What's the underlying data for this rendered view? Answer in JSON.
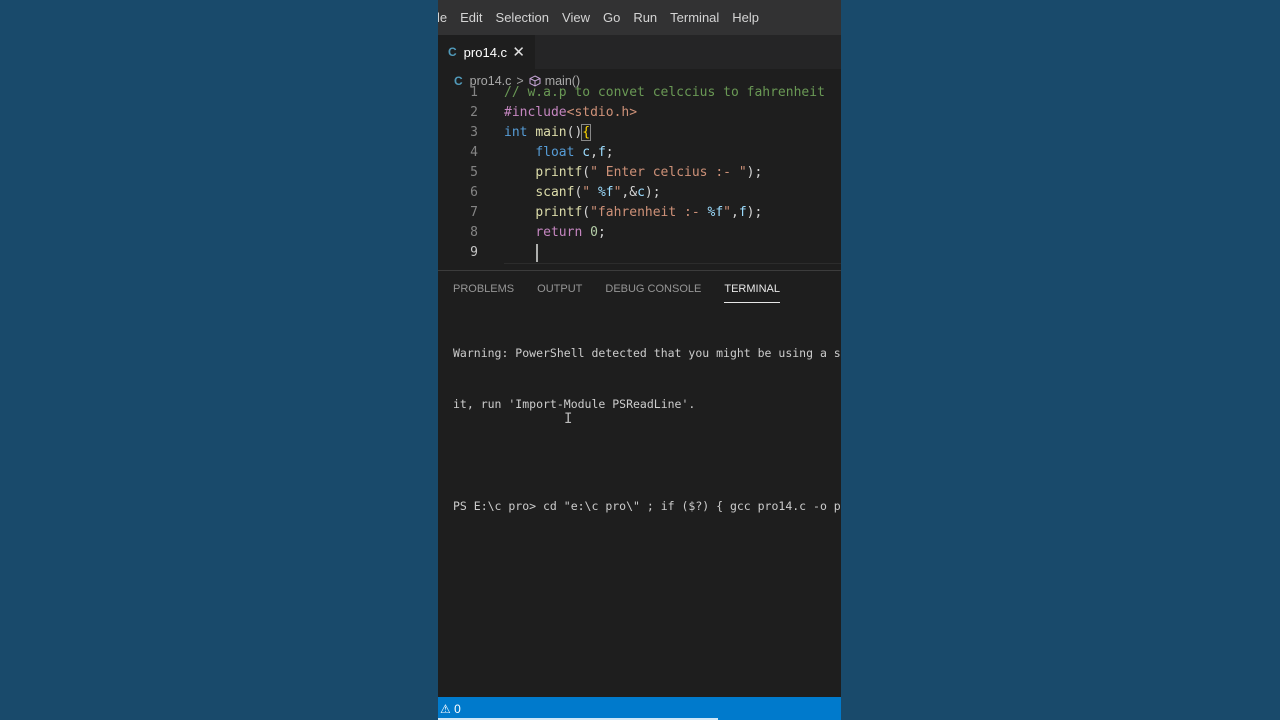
{
  "menu": [
    "le",
    "Edit",
    "Selection",
    "View",
    "Go",
    "Run",
    "Terminal",
    "Help"
  ],
  "tab": {
    "icon": "c-file-icon",
    "icon_text": "C",
    "label": "pro14.c",
    "close_glyph": "✕"
  },
  "breadcrumb": {
    "icon_text": "C",
    "file": "pro14.c",
    "separator": ">",
    "symbol": "main()"
  },
  "editor": {
    "line_numbers": [
      "1",
      "2",
      "3",
      "4",
      "5",
      "6",
      "7",
      "8",
      "9"
    ],
    "lines": [
      [
        {
          "t": "// w.a.p to convet celccius to fahrenheit",
          "c": "comment"
        }
      ],
      [
        {
          "t": "#include",
          "c": "preproc"
        },
        {
          "t": "<stdio.h>",
          "c": "incl"
        }
      ],
      [
        {
          "t": "int",
          "c": "kw"
        },
        {
          "t": " ",
          "c": "punc"
        },
        {
          "t": "main",
          "c": "fn"
        },
        {
          "t": "()",
          "c": "punc"
        },
        {
          "t": "{",
          "c": "brace"
        }
      ],
      [
        {
          "t": "    ",
          "c": "punc"
        },
        {
          "t": "float",
          "c": "kw"
        },
        {
          "t": " ",
          "c": "punc"
        },
        {
          "t": "c",
          "c": "id"
        },
        {
          "t": ",",
          "c": "punc"
        },
        {
          "t": "f",
          "c": "id"
        },
        {
          "t": ";",
          "c": "punc"
        }
      ],
      [
        {
          "t": "    ",
          "c": "punc"
        },
        {
          "t": "printf",
          "c": "fn"
        },
        {
          "t": "(",
          "c": "punc"
        },
        {
          "t": "\" Enter celcius :- \"",
          "c": "str"
        },
        {
          "t": ");",
          "c": "punc"
        }
      ],
      [
        {
          "t": "    ",
          "c": "punc"
        },
        {
          "t": "scanf",
          "c": "fn"
        },
        {
          "t": "(",
          "c": "punc"
        },
        {
          "t": "\" ",
          "c": "str"
        },
        {
          "t": "%f",
          "c": "fmt"
        },
        {
          "t": "\"",
          "c": "str"
        },
        {
          "t": ",&",
          "c": "punc"
        },
        {
          "t": "c",
          "c": "id"
        },
        {
          "t": ");",
          "c": "punc"
        }
      ],
      [
        {
          "t": "    ",
          "c": "punc"
        },
        {
          "t": "printf",
          "c": "fn"
        },
        {
          "t": "(",
          "c": "punc"
        },
        {
          "t": "\"fahrenheit :- ",
          "c": "str"
        },
        {
          "t": "%f",
          "c": "fmt"
        },
        {
          "t": "\"",
          "c": "str"
        },
        {
          "t": ",",
          "c": "punc"
        },
        {
          "t": "f",
          "c": "id"
        },
        {
          "t": ");",
          "c": "punc"
        }
      ],
      [
        {
          "t": "    ",
          "c": "punc"
        },
        {
          "t": "return",
          "c": "ctrl"
        },
        {
          "t": " ",
          "c": "punc"
        },
        {
          "t": "0",
          "c": "num"
        },
        {
          "t": ";",
          "c": "punc"
        }
      ],
      []
    ]
  },
  "panel": {
    "tabs": [
      "PROBLEMS",
      "OUTPUT",
      "DEBUG CONSOLE",
      "TERMINAL"
    ],
    "active_tab": "TERMINAL",
    "terminal": {
      "warning_line1": "Warning: PowerShell detected that you might be using a s",
      "warning_line2": "it, run 'Import-Module PSReadLine'.",
      "command_line": "PS E:\\c pro> cd \"e:\\c pro\\\" ; if ($?) { gcc pro14.c -o p"
    }
  },
  "statusbar": {
    "text": "⚠ 0",
    "accent": "#007acc"
  }
}
